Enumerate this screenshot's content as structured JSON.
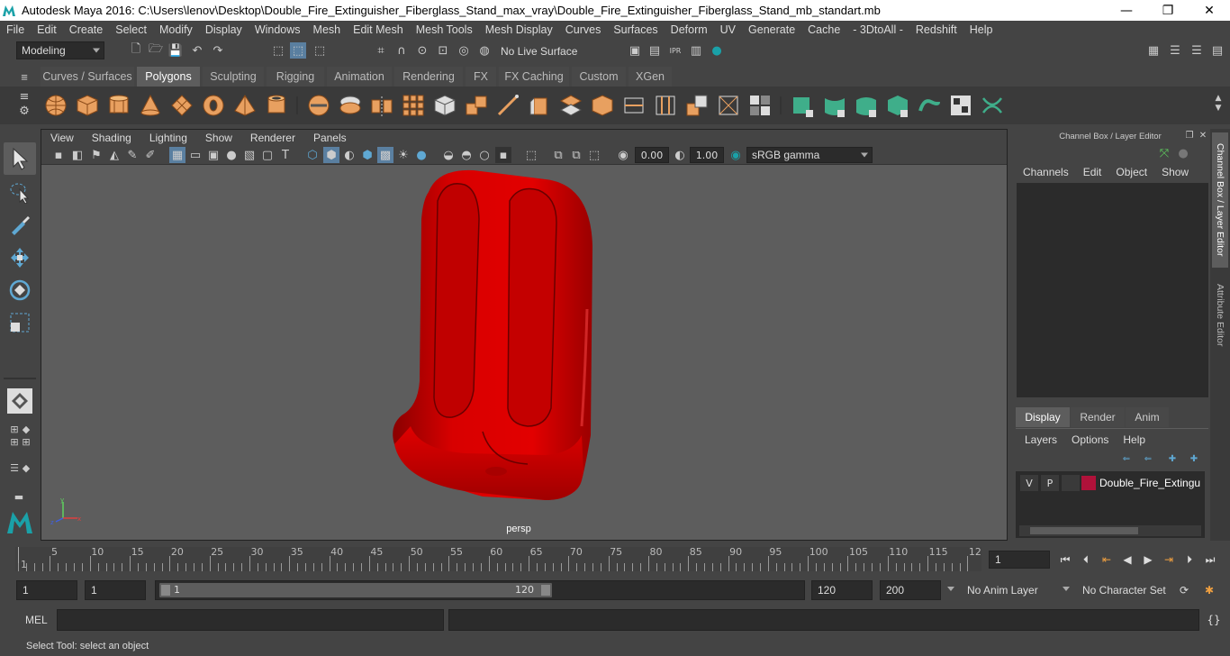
{
  "window": {
    "title": "Autodesk Maya 2016: C:\\Users\\lenov\\Desktop\\Double_Fire_Extinguisher_Fiberglass_Stand_max_vray\\Double_Fire_Extinguisher_Fiberglass_Stand_mb_standart.mb",
    "minimize": "—",
    "maximize": "❐",
    "close": "✕"
  },
  "menubar": [
    "File",
    "Edit",
    "Create",
    "Select",
    "Modify",
    "Display",
    "Windows",
    "Mesh",
    "Edit Mesh",
    "Mesh Tools",
    "Mesh Display",
    "Curves",
    "Surfaces",
    "Deform",
    "UV",
    "Generate",
    "Cache",
    "- 3DtoAll -",
    "Redshift",
    "Help"
  ],
  "statusline": {
    "mode": "Modeling",
    "live_surface": "No Live Surface"
  },
  "shelf_tabs": [
    "Curves / Surfaces",
    "Polygons",
    "Sculpting",
    "Rigging",
    "Animation",
    "Rendering",
    "FX",
    "FX Caching",
    "Custom",
    "XGen"
  ],
  "shelf_active": "Polygons",
  "viewport": {
    "menu": [
      "View",
      "Shading",
      "Lighting",
      "Show",
      "Renderer",
      "Panels"
    ],
    "exposure": "0.00",
    "gamma": "1.00",
    "color_space": "sRGB gamma",
    "camera_label": "persp",
    "object_color": "#d40000"
  },
  "channel_box": {
    "title": "Channel Box / Layer Editor",
    "menu": [
      "Channels",
      "Edit",
      "Object",
      "Show"
    ],
    "layer_tabs": [
      "Display",
      "Render",
      "Anim"
    ],
    "layer_menu": [
      "Layers",
      "Options",
      "Help"
    ],
    "layer": {
      "v": "V",
      "p": "P",
      "name": "Double_Fire_Extinguis",
      "color": "#b0123a"
    }
  },
  "side_tabs": [
    "Channel Box / Layer Editor",
    "Attribute Editor"
  ],
  "timeline": {
    "ticks": [
      "5",
      "10",
      "15",
      "20",
      "25",
      "30",
      "35",
      "40",
      "45",
      "50",
      "55",
      "60",
      "65",
      "70",
      "75",
      "80",
      "85",
      "90",
      "95",
      "100",
      "105",
      "110",
      "115",
      "12"
    ],
    "start_label": "1",
    "current_frame": "1"
  },
  "range": {
    "start": "1",
    "start2": "1",
    "slider_start": "1",
    "slider_end": "120",
    "end": "120",
    "end2": "200",
    "anim_layer": "No Anim Layer",
    "char_set": "No Character Set"
  },
  "mel": {
    "label": "MEL"
  },
  "help_line": "Select Tool: select an object"
}
